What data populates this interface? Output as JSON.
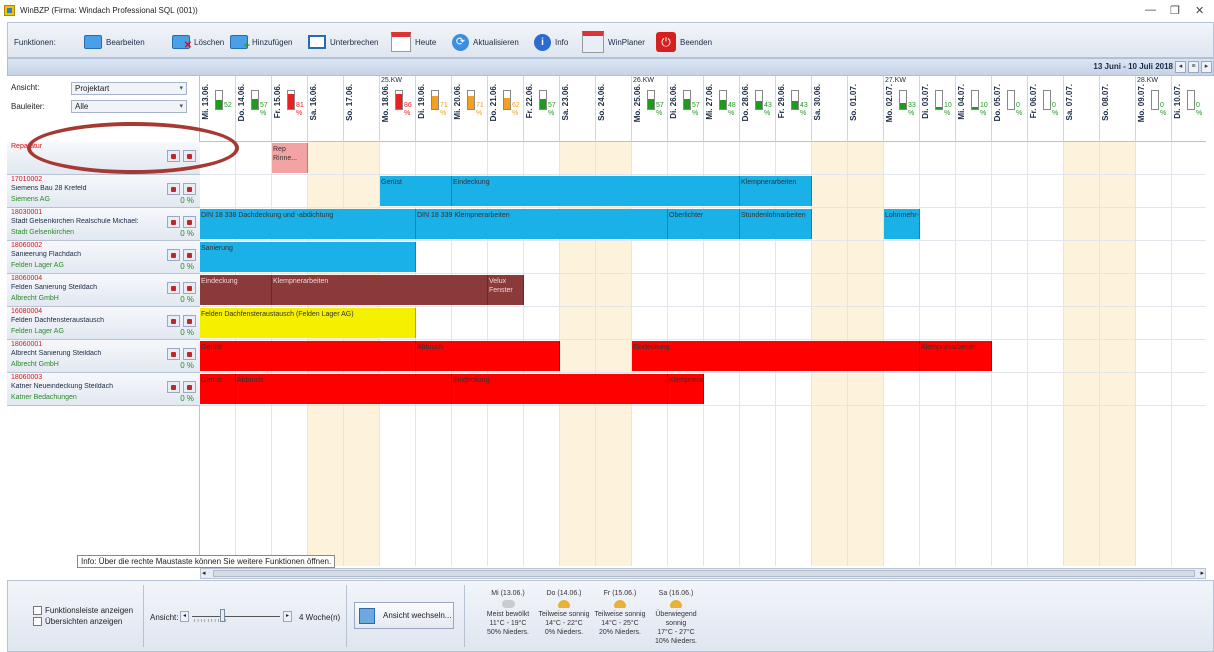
{
  "window": {
    "title": "WinBZP (Firma: Windach Professional SQL (001))"
  },
  "toolbar": {
    "label": "Funktionen:",
    "buttons": [
      {
        "label": "Bearbeiten"
      },
      {
        "label": "Löschen"
      },
      {
        "label": "Hinzufügen"
      },
      {
        "label": "Unterbrechen"
      },
      {
        "label": "Heute"
      },
      {
        "label": "Aktualisieren"
      },
      {
        "label": "Info"
      },
      {
        "label": "WinPlaner"
      },
      {
        "label": "Beenden"
      }
    ]
  },
  "datebar": {
    "range": "13 Juni - 10 Juli 2018"
  },
  "filters": {
    "ansicht_label": "Ansicht:",
    "ansicht_value": "Projektart",
    "bauleiter_label": "Bauleiter:",
    "bauleiter_value": "Alle"
  },
  "projects": [
    {
      "id": "Reparatur",
      "name": "",
      "client": "",
      "pct": ""
    },
    {
      "id": "17010002",
      "name": "Siemens Bau 28 Krefeld",
      "client": "Siemens AG",
      "pct": "0 %"
    },
    {
      "id": "18030001",
      "name": "Stadt Gelsenkirchen Realschule Michael:",
      "client": "Stadt Gelsenkirchen",
      "pct": "0 %"
    },
    {
      "id": "18060002",
      "name": "Sanieerung Flachdach",
      "client": "Felden Lager AG",
      "pct": "0 %"
    },
    {
      "id": "18060004",
      "name": "Felden Sanierung Steildach",
      "client": "Albrecht GmbH",
      "pct": "0 %"
    },
    {
      "id": "16080004",
      "name": "Felden Dachfensteraustausch",
      "client": "Felden Lager AG",
      "pct": "0 %"
    },
    {
      "id": "18060001",
      "name": "Albrecht Sanierung Steildach",
      "client": "Albrecht GmbH",
      "pct": "0 %"
    },
    {
      "id": "18060003",
      "name": "Katner Neueindeckung Steildach",
      "client": "Katner Bedachungen",
      "pct": "0 %"
    }
  ],
  "days": [
    {
      "label": "Mi. 13.06.",
      "kw": "",
      "gauge": 52,
      "pct": "52",
      "weekend": false
    },
    {
      "label": "Do. 14.06.",
      "kw": "",
      "gauge": 57,
      "pct": "57\n%",
      "weekend": false
    },
    {
      "label": "Fr. 15.06.",
      "kw": "",
      "gauge": 81,
      "pct": "81\n%",
      "weekend": false
    },
    {
      "label": "Sa. 16.06.",
      "kw": "",
      "gauge": null,
      "pct": "",
      "weekend": true
    },
    {
      "label": "So. 17.06.",
      "kw": "",
      "gauge": null,
      "pct": "",
      "weekend": true
    },
    {
      "label": "Mo. 18.06.",
      "kw": "25.KW",
      "gauge": 86,
      "pct": "86\n%",
      "weekend": false
    },
    {
      "label": "Di. 19.06.",
      "kw": "",
      "gauge": 71,
      "pct": "71\n%",
      "weekend": false
    },
    {
      "label": "Mi. 20.06.",
      "kw": "",
      "gauge": 71,
      "pct": "71\n%",
      "weekend": false
    },
    {
      "label": "Do. 21.06.",
      "kw": "",
      "gauge": 62,
      "pct": "62\n%",
      "weekend": false
    },
    {
      "label": "Fr. 22.06.",
      "kw": "",
      "gauge": 57,
      "pct": "57\n%",
      "weekend": false
    },
    {
      "label": "Sa. 23.06.",
      "kw": "",
      "gauge": null,
      "pct": "",
      "weekend": true
    },
    {
      "label": "So. 24.06.",
      "kw": "",
      "gauge": null,
      "pct": "",
      "weekend": true
    },
    {
      "label": "Mo. 25.06.",
      "kw": "26.KW",
      "gauge": 57,
      "pct": "57\n%",
      "weekend": false
    },
    {
      "label": "Di. 26.06.",
      "kw": "",
      "gauge": 57,
      "pct": "57\n%",
      "weekend": false
    },
    {
      "label": "Mi. 27.06.",
      "kw": "",
      "gauge": 48,
      "pct": "48\n%",
      "weekend": false
    },
    {
      "label": "Do. 28.06.",
      "kw": "",
      "gauge": 43,
      "pct": "43\n%",
      "weekend": false
    },
    {
      "label": "Fr. 29.06.",
      "kw": "",
      "gauge": 43,
      "pct": "43\n%",
      "weekend": false
    },
    {
      "label": "Sa. 30.06.",
      "kw": "",
      "gauge": null,
      "pct": "",
      "weekend": true
    },
    {
      "label": "So. 01.07.",
      "kw": "",
      "gauge": null,
      "pct": "",
      "weekend": true
    },
    {
      "label": "Mo. 02.07.",
      "kw": "27.KW",
      "gauge": 33,
      "pct": "33\n%",
      "weekend": false
    },
    {
      "label": "Di. 03.07.",
      "kw": "",
      "gauge": 10,
      "pct": "10\n%",
      "weekend": false
    },
    {
      "label": "Mi. 04.07.",
      "kw": "",
      "gauge": 10,
      "pct": "10\n%",
      "weekend": false
    },
    {
      "label": "Do. 05.07.",
      "kw": "",
      "gauge": 0,
      "pct": "0\n%",
      "weekend": false
    },
    {
      "label": "Fr. 06.07.",
      "kw": "",
      "gauge": 0,
      "pct": "0\n%",
      "weekend": false
    },
    {
      "label": "Sa. 07.07.",
      "kw": "",
      "gauge": null,
      "pct": "",
      "weekend": true
    },
    {
      "label": "So. 08.07.",
      "kw": "",
      "gauge": null,
      "pct": "",
      "weekend": true
    },
    {
      "label": "Mo. 09.07.",
      "kw": "28.KW",
      "gauge": 0,
      "pct": "0\n%",
      "weekend": false
    },
    {
      "label": "Di. 10.07.",
      "kw": "",
      "gauge": 0,
      "pct": "0\n%",
      "weekend": false
    }
  ],
  "tasks": [
    {
      "row": 0,
      "start": 2,
      "span": 1,
      "text": "Rep Rinne...",
      "color": "#f4a3a3"
    },
    {
      "row": 1,
      "start": 5,
      "span": 2,
      "text": "Gerüst",
      "color": "#1ab0e8"
    },
    {
      "row": 1,
      "start": 7,
      "span": 8,
      "text": "Eindeckung",
      "color": "#1ab0e8"
    },
    {
      "row": 1,
      "start": 15,
      "span": 2,
      "text": "Klempnerarbeiten",
      "color": "#1ab0e8"
    },
    {
      "row": 2,
      "start": 0,
      "span": 6,
      "text": "DIN 18 338 Dachdeckung und -abdichtung",
      "color": "#1ab0e8"
    },
    {
      "row": 2,
      "start": 6,
      "span": 7,
      "text": "DIN 18 339 Klempnerarbeiten",
      "color": "#1ab0e8"
    },
    {
      "row": 2,
      "start": 13,
      "span": 2,
      "text": "Oberlichter",
      "color": "#1ab0e8"
    },
    {
      "row": 2,
      "start": 15,
      "span": 2,
      "text": "Stundenlohnarbeiten",
      "color": "#1ab0e8"
    },
    {
      "row": 2,
      "start": 19,
      "span": 1,
      "text": "Lohnmehr-...",
      "color": "#1ab0e8"
    },
    {
      "row": 3,
      "start": 0,
      "span": 6,
      "text": "Sanierung",
      "color": "#1ab0e8"
    },
    {
      "row": 4,
      "start": 0,
      "span": 2,
      "text": "Eindeckung",
      "color": "#8b3a3a"
    },
    {
      "row": 4,
      "start": 2,
      "span": 6,
      "text": "Klempnerarbeiten",
      "color": "#8b3a3a"
    },
    {
      "row": 4,
      "start": 8,
      "span": 1,
      "text": "Velux Fenster",
      "color": "#8b3a3a"
    },
    {
      "row": 5,
      "start": 0,
      "span": 6,
      "text": "Felden Dachfensteraustausch (Felden Lager AG)",
      "color": "#f5f000"
    },
    {
      "row": 6,
      "start": 0,
      "span": 6,
      "text": "Gerüst",
      "color": "#ff0000"
    },
    {
      "row": 6,
      "start": 6,
      "span": 4,
      "text": "Abbruch",
      "color": "#ff0000"
    },
    {
      "row": 6,
      "start": 12,
      "span": 8,
      "text": "Eindeckung",
      "color": "#ff0000"
    },
    {
      "row": 6,
      "start": 20,
      "span": 2,
      "text": "Klempnerarbeiten",
      "color": "#ff0000"
    },
    {
      "row": 7,
      "start": 0,
      "span": 1,
      "text": "Gerüst",
      "color": "#ff0000"
    },
    {
      "row": 7,
      "start": 1,
      "span": 6,
      "text": "Abbruch",
      "color": "#ff0000"
    },
    {
      "row": 7,
      "start": 7,
      "span": 6,
      "text": "Eindeckung",
      "color": "#ff0000"
    },
    {
      "row": 7,
      "start": 13,
      "span": 1,
      "text": "Klempnerarbeiten",
      "color": "#ff0000"
    }
  ],
  "tooltip": "Info: Über die rechte Maustaste können Sie weitere Funktionen öffnen.",
  "bottom": {
    "chk1": "Funktionsleiste anzeigen",
    "chk2": "Übersichten anzeigen",
    "ansicht_label": "Ansicht:",
    "weeks": "4 Woche(n)",
    "switch_button": "Ansicht wechseln..."
  },
  "weather": [
    {
      "day": "Mi (13.06.)",
      "desc": "Meist bewölkt",
      "temp": "11°C - 19°C",
      "rain": "50% Nieders.",
      "icon": "cloud-icon"
    },
    {
      "day": "Do (14.06.)",
      "desc": "Teilweise sonnig",
      "temp": "14°C - 22°C",
      "rain": "0% Nieders.",
      "icon": "sun-cloud-icon"
    },
    {
      "day": "Fr (15.06.)",
      "desc": "Teilweise sonnig",
      "temp": "14°C - 25°C",
      "rain": "20% Nieders.",
      "icon": "sun-cloud-icon"
    },
    {
      "day": "Sa (16.06.)",
      "desc": "Überwiegend sonnig",
      "temp": "17°C - 27°C",
      "rain": "10% Nieders.",
      "icon": "sun-icon"
    }
  ],
  "colors": {
    "accent": "#1ab0e8",
    "weekend": "#fdf2dc",
    "annotation": "#a83832"
  }
}
